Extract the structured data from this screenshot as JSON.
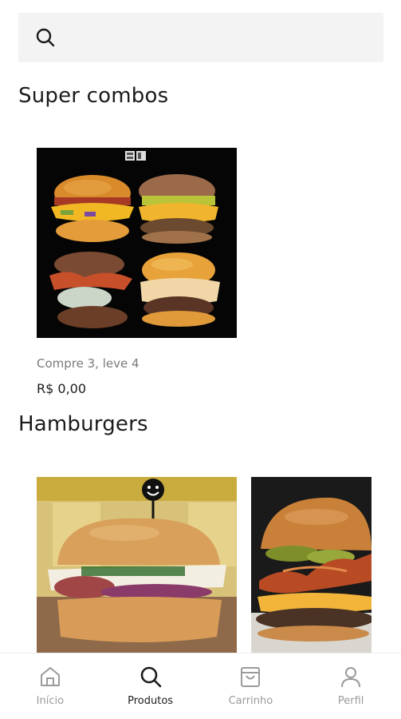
{
  "search": {
    "placeholder": "",
    "icon": "search-icon"
  },
  "sections": [
    {
      "title": "Super combos",
      "products": [
        {
          "name": "Compre 3, leve 4",
          "price": "R$ 0,00"
        }
      ]
    },
    {
      "title": "Hamburgers",
      "products": [
        {
          "name": "",
          "price": ""
        },
        {
          "name": "",
          "price": ""
        }
      ]
    }
  ],
  "bottom_nav": {
    "items": [
      {
        "label": "Início",
        "icon": "home-icon",
        "active": false
      },
      {
        "label": "Produtos",
        "icon": "search-icon",
        "active": true
      },
      {
        "label": "Carrinho",
        "icon": "shopping-bag-icon",
        "active": false
      },
      {
        "label": "Perfil",
        "icon": "user-icon",
        "active": false
      }
    ]
  },
  "colors": {
    "text_primary": "#1b1b1b",
    "text_secondary": "#7a7a7a",
    "nav_inactive": "#9a9a9a",
    "search_bg": "#f3f3f3"
  }
}
